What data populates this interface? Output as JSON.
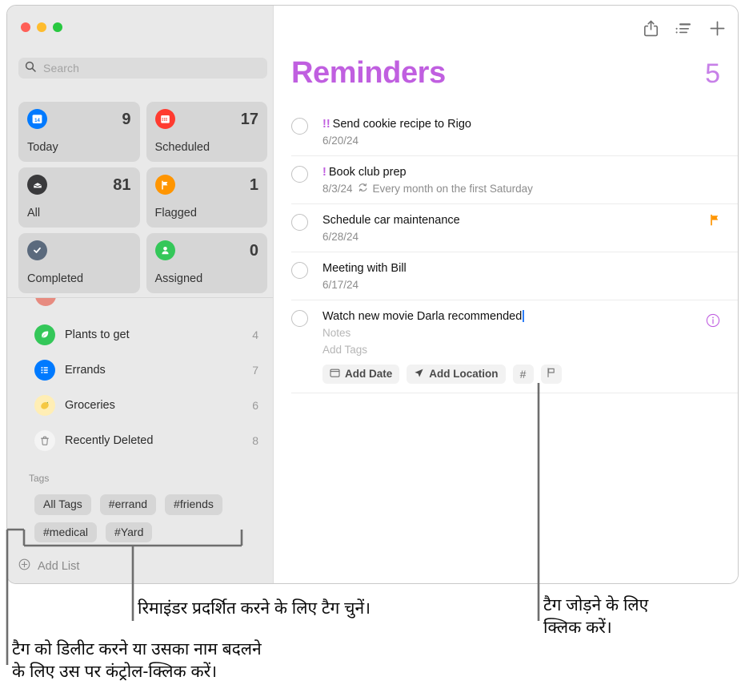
{
  "window": {
    "traffic_lights": [
      "close",
      "minimize",
      "zoom"
    ],
    "colors": {
      "accent": "#c05fe0",
      "sidebar_bg": "#e9e9e9",
      "card_bg": "#d6d6d6",
      "flag_orange": "#ff9500"
    }
  },
  "search": {
    "placeholder": "Search"
  },
  "smart_lists": [
    {
      "name": "today",
      "label": "Today",
      "count": "9",
      "icon": "calendar-icon",
      "icon_bg": "#007aff"
    },
    {
      "name": "scheduled",
      "label": "Scheduled",
      "count": "17",
      "icon": "calendar-days-icon",
      "icon_bg": "#ff3b30"
    },
    {
      "name": "all",
      "label": "All",
      "count": "81",
      "icon": "inbox-icon",
      "icon_bg": "#3a3a3c"
    },
    {
      "name": "flagged",
      "label": "Flagged",
      "count": "1",
      "icon": "flag-icon",
      "icon_bg": "#ff9500"
    },
    {
      "name": "completed",
      "label": "Completed",
      "count": "",
      "icon": "checkmark-icon",
      "icon_bg": "#5b6a7d"
    },
    {
      "name": "assigned",
      "label": "Assigned",
      "count": "0",
      "icon": "person-icon",
      "icon_bg": "#34c759"
    }
  ],
  "lists": [
    {
      "label": "Plants to get",
      "count": "4",
      "icon": "leaf-icon",
      "icon_bg": "#34c759"
    },
    {
      "label": "Errands",
      "count": "7",
      "icon": "list-icon",
      "icon_bg": "#007aff"
    },
    {
      "label": "Groceries",
      "count": "6",
      "icon": "lemon-icon",
      "icon_bg": "#ffe9a8"
    },
    {
      "label": "Recently Deleted",
      "count": "8",
      "icon": "trash-icon",
      "icon_bg": "#f2f2f2"
    }
  ],
  "tags_section": {
    "header": "Tags",
    "pills": [
      "All Tags",
      "#errand",
      "#friends",
      "#medical",
      "#Yard"
    ]
  },
  "add_list": {
    "label": "Add List",
    "icon": "plus-circle-icon"
  },
  "detail": {
    "title": "Reminders",
    "count": "5",
    "toolbar": [
      {
        "name": "share-icon",
        "label": "Share"
      },
      {
        "name": "list-view-icon",
        "label": "View Options"
      },
      {
        "name": "plus-icon",
        "label": "New Reminder"
      }
    ],
    "reminders": [
      {
        "priority": "!!",
        "title": "Send cookie recipe to Rigo",
        "date": "6/20/24",
        "repeat": "",
        "flagged": false,
        "selected": false
      },
      {
        "priority": "!",
        "title": "Book club prep",
        "date": "8/3/24",
        "repeat": "Every month on the first Saturday",
        "flagged": false,
        "selected": false
      },
      {
        "priority": "",
        "title": "Schedule car maintenance",
        "date": "6/28/24",
        "repeat": "",
        "flagged": true,
        "selected": false
      },
      {
        "priority": "",
        "title": "Meeting with Bill",
        "date": "6/17/24",
        "repeat": "",
        "flagged": false,
        "selected": false
      }
    ],
    "editing_reminder": {
      "title": "Watch new movie Darla recommended",
      "notes_placeholder": "Notes",
      "tags_placeholder": "Add Tags",
      "chips": [
        {
          "name": "add-date-chip",
          "label": "Add Date",
          "icon": "calendar-icon"
        },
        {
          "name": "add-location-chip",
          "label": "Add Location",
          "icon": "location-arrow-icon"
        },
        {
          "name": "add-tag-chip",
          "label": "#",
          "icon": "hash-icon"
        },
        {
          "name": "add-flag-chip",
          "label": "",
          "icon": "flag-outline-icon"
        }
      ],
      "info_icon": "info-circle-icon"
    }
  },
  "callouts": [
    {
      "name": "callout-select-tag",
      "text": "रिमाइंडर प्रदर्शित करने के लिए टैग चुनें।"
    },
    {
      "name": "callout-add-tag",
      "text": "टैग जोड़ने के लिए\nक्लिक करें।"
    },
    {
      "name": "callout-delete-tag",
      "text": "टैग को डिलीट करने या उसका नाम बदलने\nके लिए उस पर कंट्रोल-क्लिक करें।"
    }
  ]
}
